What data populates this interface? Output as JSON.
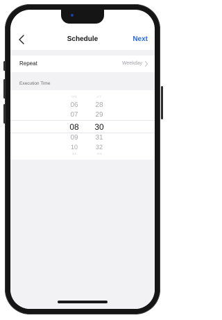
{
  "header": {
    "title": "Schedule",
    "next_label": "Next"
  },
  "repeat": {
    "label": "Repeat",
    "value": "Weekday"
  },
  "execution_time": {
    "label": "Execution Time",
    "hours": [
      "05",
      "06",
      "07",
      "08",
      "09",
      "10",
      "11"
    ],
    "minutes": [
      "27",
      "28",
      "29",
      "30",
      "31",
      "32",
      "33"
    ],
    "selected_hour": "08",
    "selected_minute": "30"
  },
  "colors": {
    "accent": "#2a6ae8",
    "section_bg": "#f2f2f4",
    "muted_text": "#a3a3a8"
  }
}
